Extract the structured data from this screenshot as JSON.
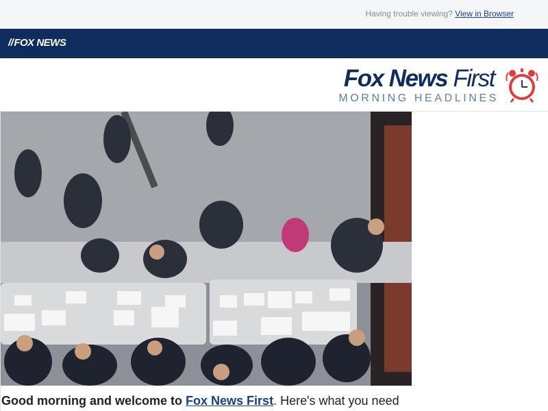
{
  "preheader": {
    "trouble_text": "Having trouble viewing?",
    "view_link": "View in Browser"
  },
  "navbar": {
    "logo_text": "FOX NEWS"
  },
  "brand": {
    "title_bold": "Fox News",
    "title_light": "First",
    "subtitle": "MORNING HEADLINES",
    "icon": "alarm-clock-icon",
    "accent_color": "#e23b3b"
  },
  "hero": {
    "image": "voters-at-caucus-sign-in-table-photo"
  },
  "intro": {
    "greeting": "Good morning and welcome to",
    "link": "Fox News First",
    "rest": ". Here's what you need"
  },
  "colors": {
    "navy": "#0f2c5f",
    "link": "#1a3f85",
    "muted": "#8a8a8a"
  }
}
